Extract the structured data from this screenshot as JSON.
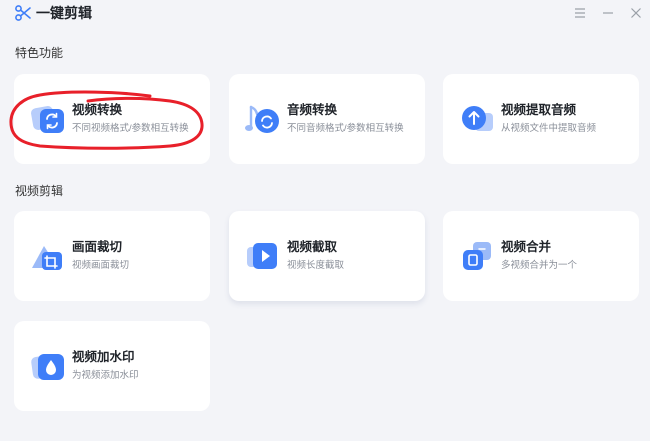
{
  "app": {
    "title": "一键剪辑",
    "logo_icon": "scissors-icon",
    "window_controls": [
      "menu-icon",
      "minimize-icon",
      "close-icon"
    ]
  },
  "sections": {
    "featured": {
      "label": "特色功能",
      "cards": [
        {
          "title": "视频转换",
          "subtitle": "不同视频格式/参数相互转换",
          "icon": "video-convert-icon"
        },
        {
          "title": "音频转换",
          "subtitle": "不同音频格式/参数相互转换",
          "icon": "audio-convert-icon"
        },
        {
          "title": "视频提取音频",
          "subtitle": "从视频文件中提取音频",
          "icon": "extract-audio-icon"
        }
      ]
    },
    "editing": {
      "label": "视频剪辑",
      "cards": [
        {
          "title": "画面裁切",
          "subtitle": "视频画面裁切",
          "icon": "crop-frame-icon"
        },
        {
          "title": "视频截取",
          "subtitle": "视频长度截取",
          "icon": "video-trim-icon"
        },
        {
          "title": "视频合并",
          "subtitle": "多视频合并为一个",
          "icon": "video-merge-icon"
        },
        {
          "title": "视频加水印",
          "subtitle": "为视频添加水印",
          "icon": "watermark-icon"
        }
      ]
    }
  },
  "colors": {
    "background": "#f3f4f8",
    "card": "#ffffff",
    "accent_blue": "#3f7ef8",
    "annotation_red": "#e8202a"
  }
}
